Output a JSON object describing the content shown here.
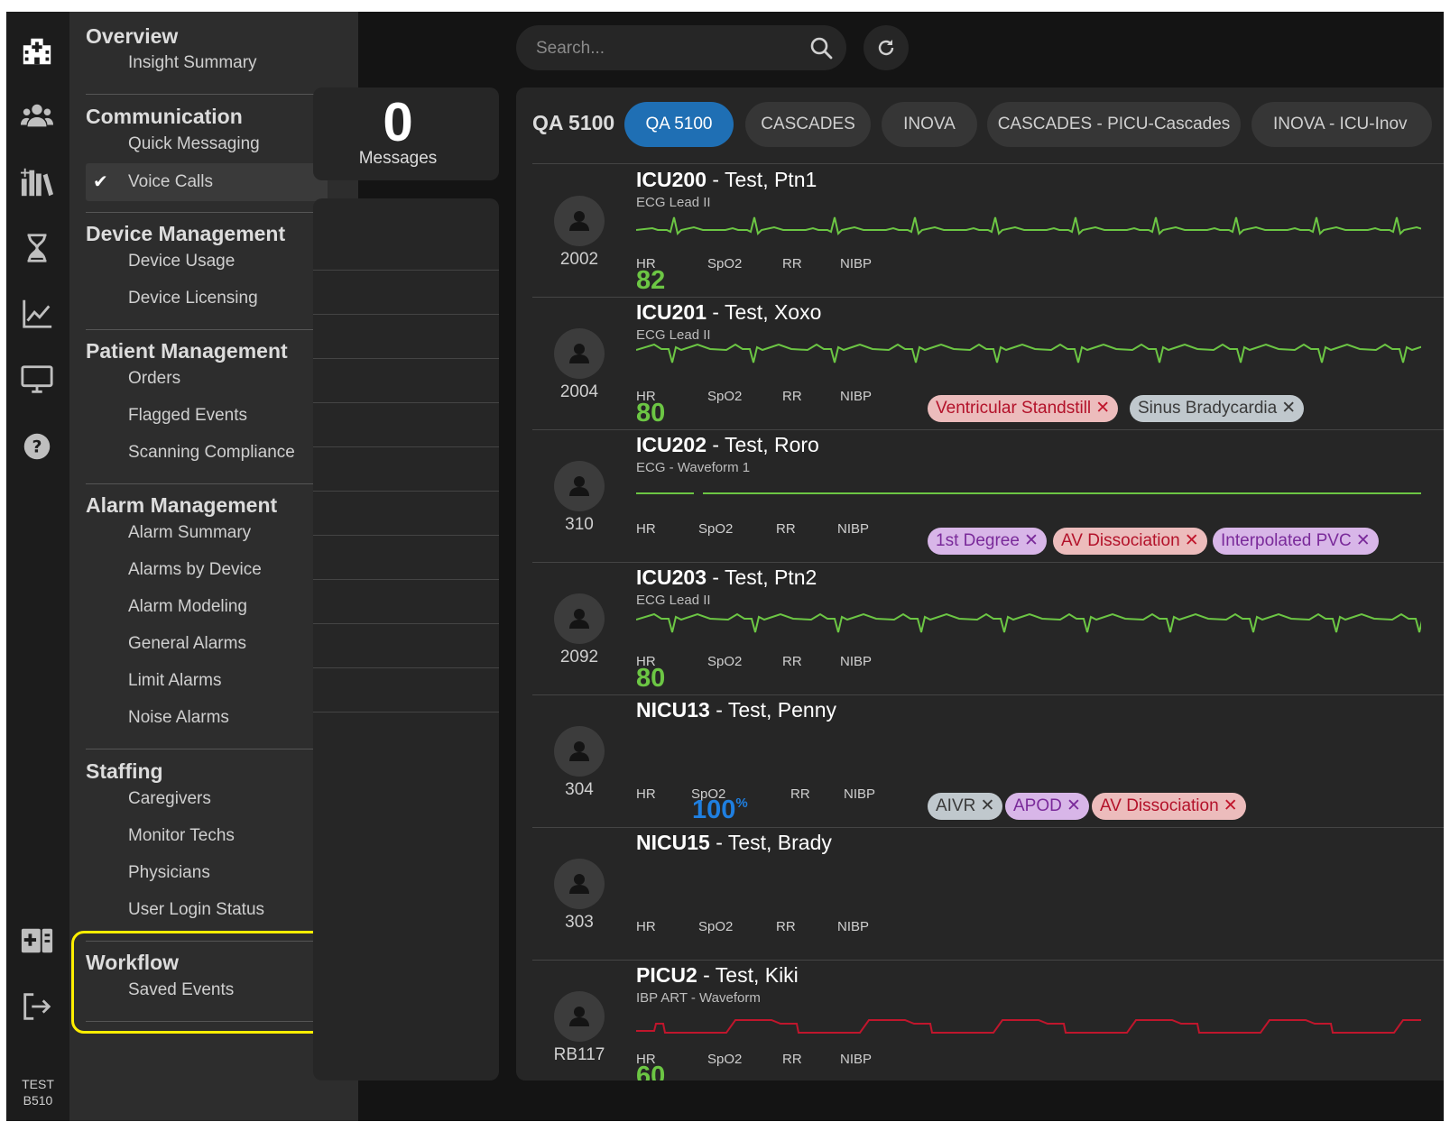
{
  "sidebar": {
    "user": "TEST B510"
  },
  "nav": {
    "sections": [
      {
        "title": "Overview",
        "items": [
          "Insight Summary"
        ]
      },
      {
        "title": "Communication",
        "items": [
          "Quick Messaging",
          "Voice Calls"
        ]
      },
      {
        "title": "Device Management",
        "items": [
          "Device Usage",
          "Device Licensing"
        ]
      },
      {
        "title": "Patient Management",
        "items": [
          "Orders",
          "Flagged Events",
          "Scanning Compliance"
        ]
      },
      {
        "title": "Alarm Management",
        "items": [
          "Alarm Summary",
          "Alarms by Device",
          "Alarm Modeling",
          "General Alarms",
          "Limit Alarms",
          "Noise Alarms"
        ]
      },
      {
        "title": "Staffing",
        "items": [
          "Caregivers",
          "Monitor Techs",
          "Physicians",
          "User Login Status"
        ]
      },
      {
        "title": "Workflow",
        "items": [
          "Saved Events"
        ]
      }
    ],
    "selected_item": "Voice Calls"
  },
  "search": {
    "placeholder": "Search..."
  },
  "messages": {
    "count": "0",
    "label": "Messages"
  },
  "unit": {
    "title": "QA 5100",
    "tabs": [
      "QA 5100",
      "CASCADES",
      "INOVA",
      "CASCADES - PICU-Cascades",
      "INOVA - ICU-Inov"
    ],
    "active_tab": "QA 5100"
  },
  "vital_labels": {
    "hr": "HR",
    "spo2": "SpO2",
    "rr": "RR",
    "nibp": "NIBP"
  },
  "patients": [
    {
      "bed_id": "ICU200",
      "name": " - Test, Ptn1",
      "monitor": "2002",
      "waveform": "ECG Lead II",
      "hr": "82",
      "chips": []
    },
    {
      "bed_id": "ICU201",
      "name": " - Test, Xoxo",
      "monitor": "2004",
      "waveform": "ECG Lead II",
      "hr": "80",
      "chips": [
        {
          "text": "Ventricular Standstill",
          "color": "red"
        },
        {
          "text": "Sinus Bradycardia",
          "color": "gray"
        }
      ]
    },
    {
      "bed_id": "ICU202",
      "name": " - Test, Roro",
      "monitor": "310",
      "waveform": "ECG - Waveform 1",
      "hr": "",
      "chips": [
        {
          "text": "1st Degree",
          "color": "purple"
        },
        {
          "text": "AV Dissociation",
          "color": "red"
        },
        {
          "text": "Interpolated PVC",
          "color": "purple"
        }
      ]
    },
    {
      "bed_id": "ICU203",
      "name": " - Test, Ptn2",
      "monitor": "2092",
      "waveform": "ECG Lead II",
      "hr": "80",
      "chips": []
    },
    {
      "bed_id": "NICU13",
      "name": " - Test, Penny",
      "monitor": "304",
      "waveform": "",
      "hr": "",
      "spo2": "100",
      "spo2_unit": "%",
      "chips": [
        {
          "text": "AIVR",
          "color": "gray"
        },
        {
          "text": "APOD",
          "color": "purple"
        },
        {
          "text": "AV Dissociation",
          "color": "red"
        }
      ]
    },
    {
      "bed_id": "NICU15",
      "name": " - Test, Brady",
      "monitor": "303",
      "waveform": "",
      "hr": "",
      "chips": []
    },
    {
      "bed_id": "PICU2",
      "name": " - Test, Kiki",
      "monitor": "RB117",
      "waveform": "IBP ART - Waveform",
      "hr": "60",
      "chips": []
    }
  ],
  "colors": {
    "accent": "#1f6fb4",
    "hr_value": "#6cc644",
    "spo2_value": "#1f7fe0",
    "ecg_wave": "#6cc644",
    "art_wave": "#c0162c",
    "highlight": "#ffee00"
  }
}
